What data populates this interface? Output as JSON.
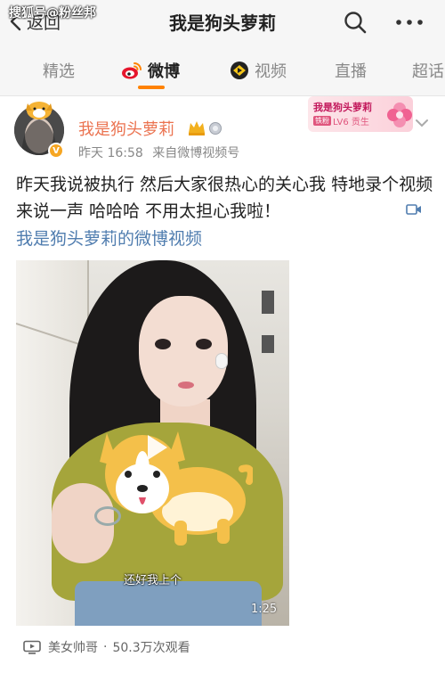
{
  "watermark": "搜狐号@粉丝邦",
  "nav": {
    "back_label": "返回",
    "title": "我是狗头萝莉"
  },
  "tabs": [
    {
      "label": "精选"
    },
    {
      "label": "微博",
      "active": true
    },
    {
      "label": "视频"
    },
    {
      "label": "直播"
    },
    {
      "label": "超话"
    }
  ],
  "post": {
    "author": "我是狗头萝莉",
    "verified_badge": "V",
    "time": "昨天 16:58",
    "source": "来自微博视频号",
    "text": "昨天我说被执行 然后大家很热心的关心我 特地录个视频来说一声 哈哈哈 不用太担心我啦！",
    "link_text": "我是狗头萝莉的微博视频",
    "fan_card": {
      "name": "我是狗头萝莉",
      "tag": "铁粉",
      "level": "LV6 贡生"
    },
    "video": {
      "caption": "还好我上个",
      "duration": "1:25",
      "channel": "美女帅哥",
      "views": "50.3万次观看"
    }
  },
  "colors": {
    "accent": "#ff8200",
    "username": "#eb7350",
    "link": "#507daf"
  }
}
